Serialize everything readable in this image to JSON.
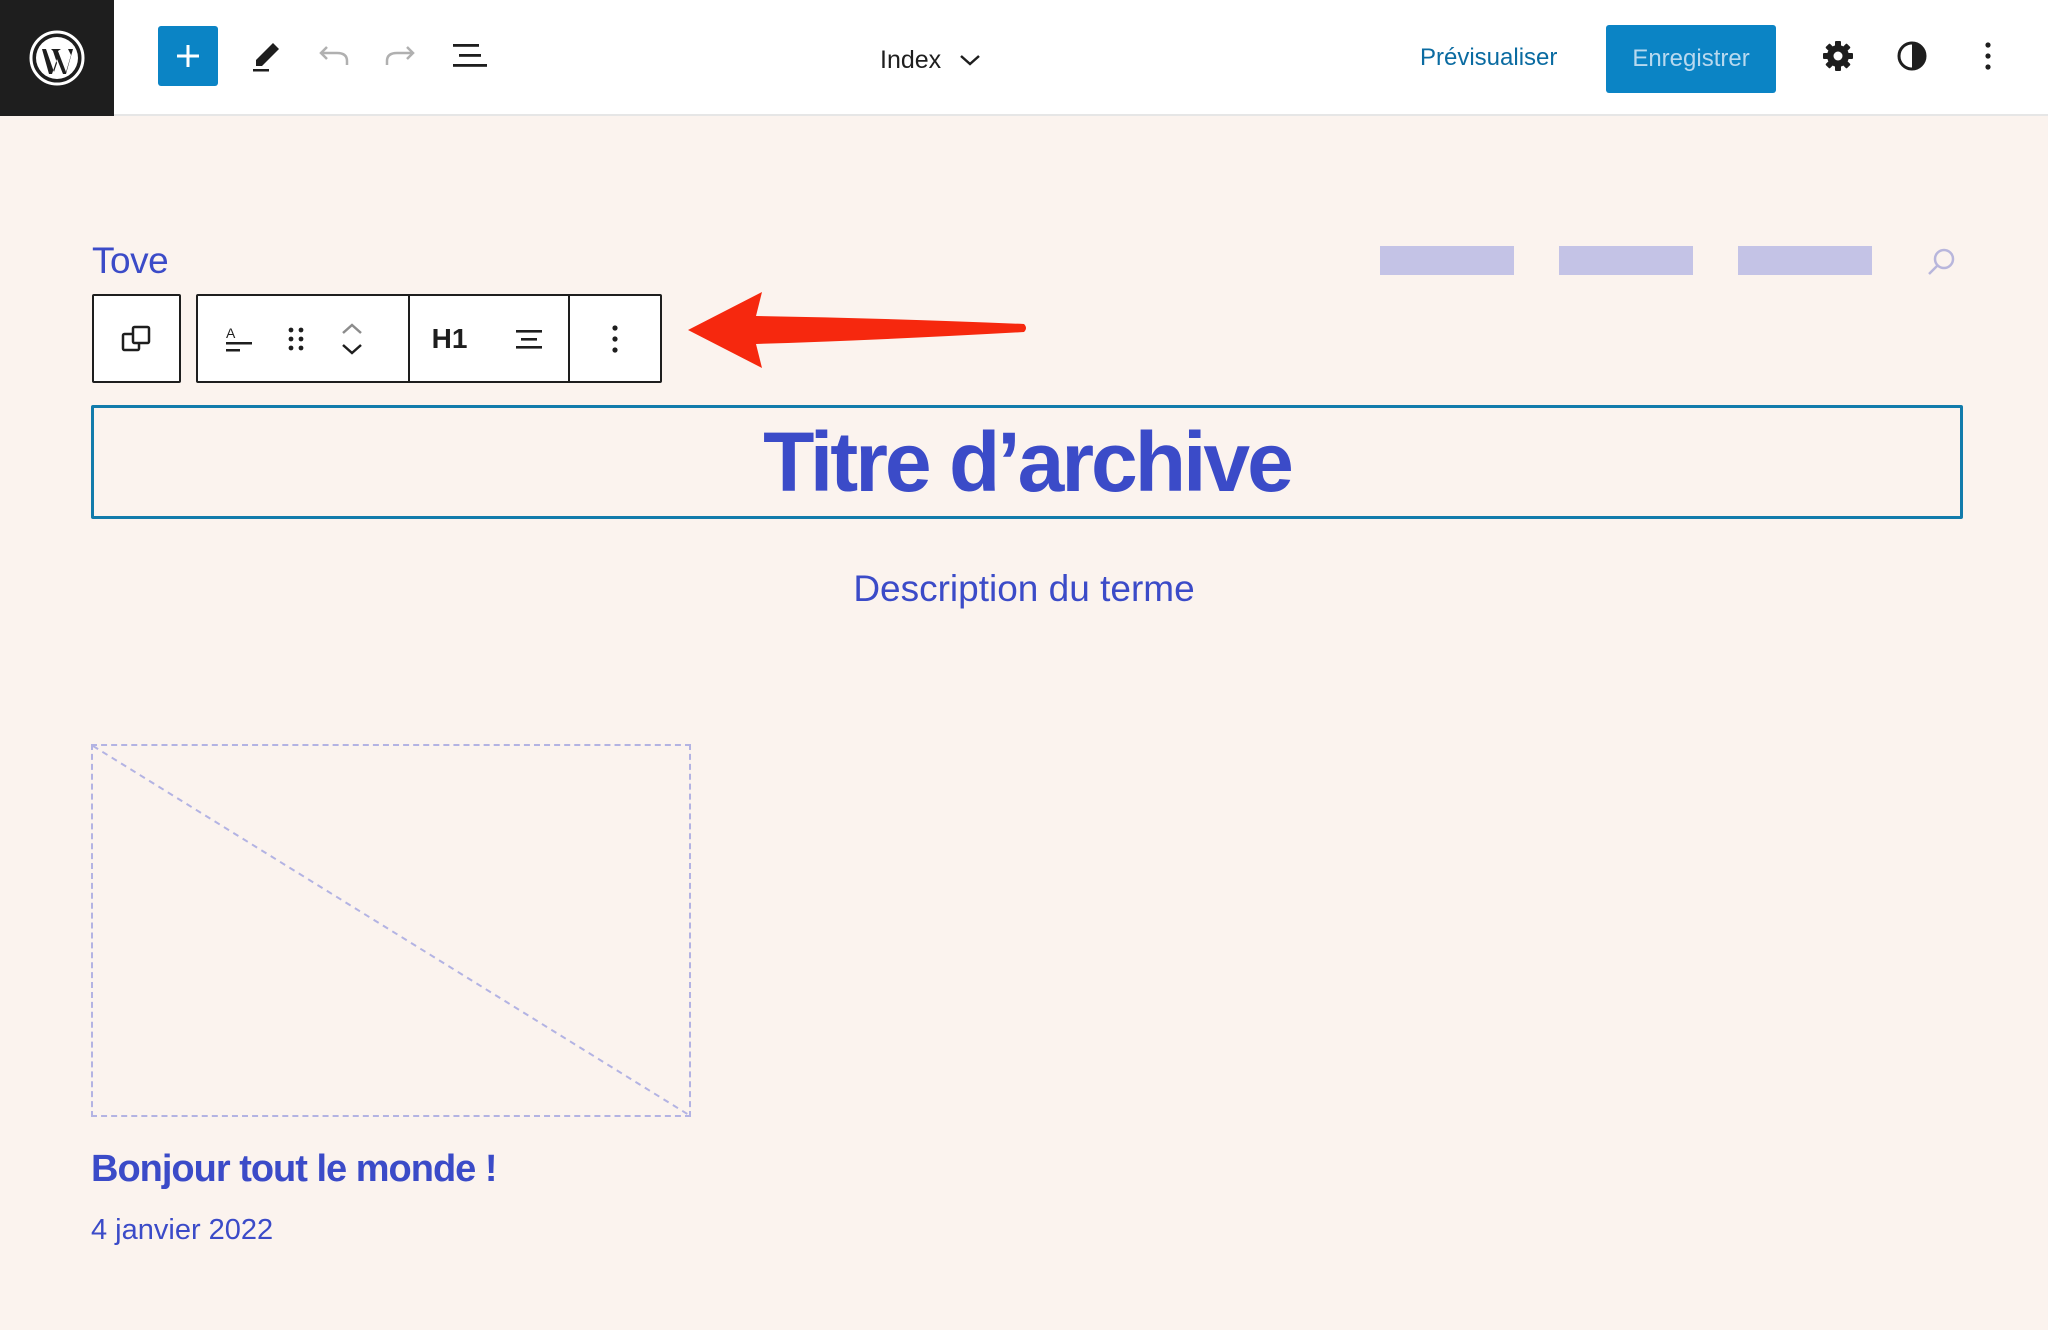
{
  "topbar": {
    "logo_icon": "wordpress-logo-icon",
    "add_icon": "plus-icon",
    "edit_icon": "pencil-icon",
    "undo_icon": "undo-icon",
    "redo_icon": "redo-icon",
    "listview_icon": "list-view-icon",
    "document_title": "Index",
    "preview_label": "Prévisualiser",
    "save_label": "Enregistrer",
    "settings_icon": "gear-icon",
    "styles_icon": "half-circle-contrast-icon",
    "options_icon": "vertical-ellipsis-icon"
  },
  "colors": {
    "accent": "#0b84c5",
    "theme_text": "#3b4bc8",
    "canvas_bg": "#fbf3ee",
    "selection_border": "#127bab",
    "annotation_arrow": "#f6280e"
  },
  "site": {
    "title": "Tove",
    "search_icon": "search-icon"
  },
  "block_toolbar": {
    "parent_icon": "select-parent-icon",
    "transform_icon": "text-align-icon",
    "drag_icon": "drag-handle-icon",
    "move_icons": [
      "chevron-up-icon",
      "chevron-down-icon"
    ],
    "heading_level": "H1",
    "align_icon": "align-center-icon",
    "more_icon": "vertical-ellipsis-icon"
  },
  "archive": {
    "heading": "Titre d’archive",
    "description": "Description du terme"
  },
  "post": {
    "title": "Bonjour tout le monde !",
    "date": "4 janvier 2022"
  }
}
